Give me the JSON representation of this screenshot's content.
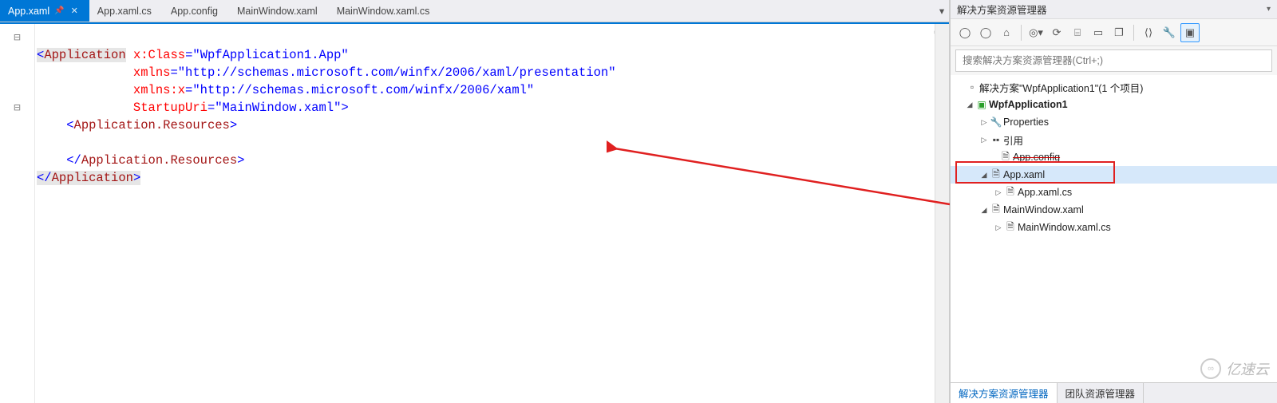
{
  "tabs": {
    "items": [
      {
        "label": "App.xaml",
        "active": true
      },
      {
        "label": "App.xaml.cs",
        "active": false
      },
      {
        "label": "App.config",
        "active": false
      },
      {
        "label": "MainWindow.xaml",
        "active": false
      },
      {
        "label": "MainWindow.xaml.cs",
        "active": false
      }
    ]
  },
  "code": {
    "t1a": "<",
    "t1b": "Application",
    "t1c": " ",
    "t1d": "x:Class",
    "t1e": "=",
    "t1f": "\"WpfApplication1.App\"",
    "t2a": "xmlns",
    "t2b": "=",
    "t2c": "\"http://schemas.microsoft.com/winfx/2006/xaml/presentation\"",
    "t3a": "xmlns:x",
    "t3b": "=",
    "t3c": "\"http://schemas.microsoft.com/winfx/2006/xaml\"",
    "t4a": "StartupUri",
    "t4b": "=",
    "t4c": "\"MainWindow.xaml\"",
    "t4d": ">",
    "t5a": "<",
    "t5b": "Application.Resources",
    "t5c": ">",
    "t6": "",
    "t7a": "</",
    "t7b": "Application.Resources",
    "t7c": ">",
    "t8a": "</",
    "t8b": "Application",
    "t8c": ">"
  },
  "panel": {
    "title": "解决方案资源管理器",
    "search_placeholder": "搜索解决方案资源管理器(Ctrl+;)",
    "solution_label": "解决方案\"WpfApplication1\"(1 个项目)",
    "project_label": "WpfApplication1",
    "nodes": {
      "properties": "Properties",
      "references": "引用",
      "app_config": "App.config",
      "app_xaml": "App.xaml",
      "app_xaml_cs": "App.xaml.cs",
      "mainwindow_xaml": "MainWindow.xaml",
      "mainwindow_xaml_cs": "MainWindow.xaml.cs"
    },
    "bottom_tabs": {
      "solution": "解决方案资源管理器",
      "team": "团队资源管理器"
    }
  },
  "watermark": "亿速云"
}
